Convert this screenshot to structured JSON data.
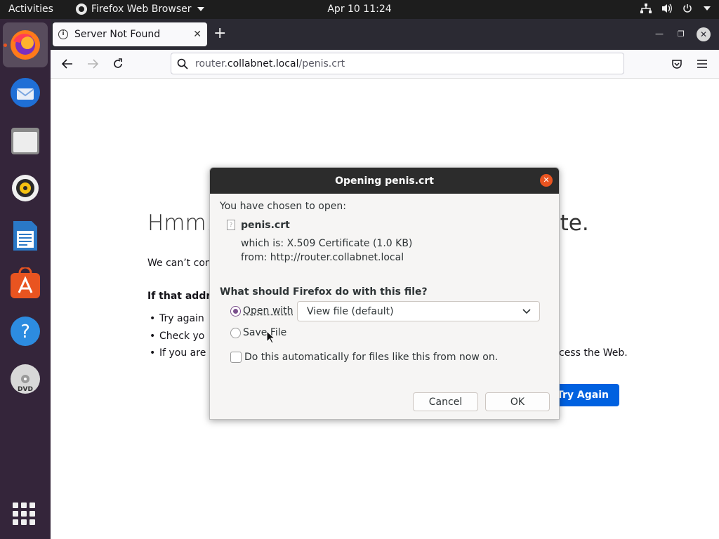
{
  "topbar": {
    "activities": "Activities",
    "app_name": "Firefox Web Browser",
    "clock": "Apr 10  11:24"
  },
  "dock": {
    "items": [
      {
        "name": "firefox-icon"
      },
      {
        "name": "thunderbird-icon"
      },
      {
        "name": "files-icon"
      },
      {
        "name": "rhythmbox-icon"
      },
      {
        "name": "libreoffice-writer-icon"
      },
      {
        "name": "software-center-icon"
      },
      {
        "name": "help-icon"
      },
      {
        "name": "dvd-icon"
      }
    ]
  },
  "browser": {
    "tab_title": "Server Not Found",
    "url_host": "router.collabnet.local",
    "url_path": "/penis.crt",
    "url_prefix": "router."
  },
  "page": {
    "title_start": "Hmm.",
    "title_end": "ite.",
    "desc_start": "We can’t conn",
    "sub_start": "If that addre",
    "bullets": [
      "Try again",
      "Check yo",
      "If you are"
    ],
    "bullet3_end": "cess the Web.",
    "try_again": "Try Again"
  },
  "dialog": {
    "title": "Opening penis.crt",
    "chosen": "You have chosen to open:",
    "filename": "penis.crt",
    "which_is": "which is:  X.509 Certificate (1.0 KB)",
    "from": "from:  http://router.collabnet.local",
    "question": "What should Firefox do with this file?",
    "open_with": "Open with",
    "open_with_app": "View file (default)",
    "save_file": "Save File",
    "auto_label": "Do this automatically for files like this from now on.",
    "cancel": "Cancel",
    "ok": "OK",
    "open_with_selected": true
  },
  "colors": {
    "accent": "#e95420",
    "radio_checked": "#7a4f8c",
    "try_again_bg": "#0061e0"
  }
}
